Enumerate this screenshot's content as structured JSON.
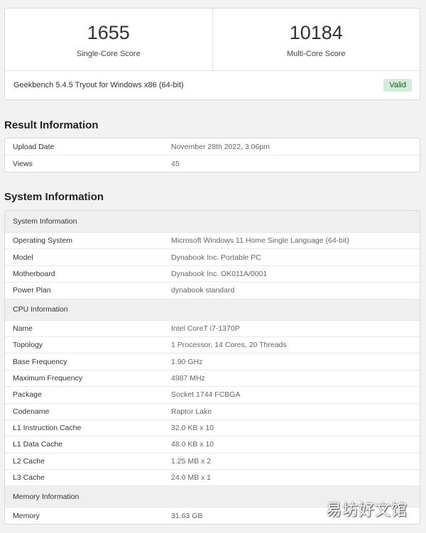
{
  "scores": {
    "single": {
      "value": "1655",
      "label": "Single-Core Score"
    },
    "multi": {
      "value": "10184",
      "label": "Multi-Core Score"
    }
  },
  "version": {
    "text": "Geekbench 5.4.5 Tryout for Windows x86 (64-bit)",
    "badge": "Valid"
  },
  "result_info": {
    "title": "Result Information",
    "rows": [
      {
        "k": "Upload Date",
        "v": "November 28th 2022, 3:06pm"
      },
      {
        "k": "Views",
        "v": "45"
      }
    ]
  },
  "system_info": {
    "title": "System Information",
    "system_header": "System Information",
    "system_rows": [
      {
        "k": "Operating System",
        "v": "Microsoft Windows 11 Home Single Language (64-bit)"
      },
      {
        "k": "Model",
        "v": "Dynabook Inc. Portable PC"
      },
      {
        "k": "Motherboard",
        "v": "Dynabook Inc. OK011A/0001"
      },
      {
        "k": "Power Plan",
        "v": "dynabook standard"
      }
    ],
    "cpu_header": "CPU Information",
    "cpu_rows": [
      {
        "k": "Name",
        "v": "Intel CoreT i7-1370P"
      },
      {
        "k": "Topology",
        "v": "1 Processor, 14 Cores, 20 Threads"
      },
      {
        "k": "Base Frequency",
        "v": "1.90 GHz"
      },
      {
        "k": "Maximum Frequency",
        "v": "4987 MHz"
      },
      {
        "k": "Package",
        "v": "Socket 1744 FCBGA"
      },
      {
        "k": "Codename",
        "v": "Raptor Lake"
      },
      {
        "k": "L1 Instruction Cache",
        "v": "32.0 KB x 10"
      },
      {
        "k": "L1 Data Cache",
        "v": "48.0 KB x 10"
      },
      {
        "k": "L2 Cache",
        "v": "1.25 MB x 2"
      },
      {
        "k": "L3 Cache",
        "v": "24.0 MB x 1"
      }
    ],
    "memory_header": "Memory Information",
    "memory_rows": [
      {
        "k": "Memory",
        "v": "31.63 GB"
      }
    ]
  },
  "watermark": "易坊好文馆"
}
